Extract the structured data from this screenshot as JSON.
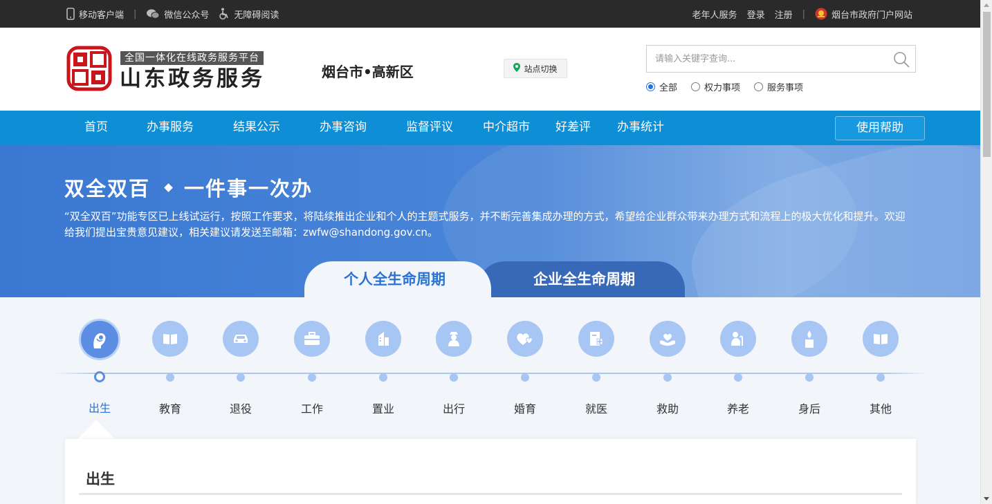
{
  "topbar": {
    "mobile_client": "移动客户端",
    "wechat": "微信公众号",
    "accessible": "无障碍阅读",
    "elder_service": "老年人服务",
    "login": "登录",
    "register": "注册",
    "gov_portal": "烟台市政府门户网站",
    "sep": "|"
  },
  "header": {
    "logo_subtitle": "全国一体化在线政务服务平台",
    "logo_title": "山东政务服务",
    "city": "烟台市•高新区",
    "site_switch": "站点切换",
    "search_placeholder": "请输入关键字查询...",
    "search_scope": [
      {
        "label": "全部",
        "selected": true
      },
      {
        "label": "权力事项",
        "selected": false
      },
      {
        "label": "服务事项",
        "selected": false
      }
    ]
  },
  "nav": {
    "items": [
      "首页",
      "办事服务",
      "结果公示",
      "办事咨询",
      "监督评议",
      "中介超市",
      "好差评",
      "办事统计"
    ],
    "help": "使用帮助"
  },
  "banner": {
    "title_left": "双全双百",
    "title_right": "一件事一次办",
    "description": "“双全双百”功能专区已上线试运行，按照工作要求，将陆续推出企业和个人的主题式服务，并不断完善集成办理的方式，希望给企业群众带来办理方式和流程上的极大优化和提升。欢迎给我们提出宝贵意见建议，相关建议请发送至邮箱：zwfw@shandong.gov.cn。",
    "tab_personal": "个人全生命周期",
    "tab_corporate": "企业全生命周期"
  },
  "lifecycle": {
    "active_index": 0,
    "stages": [
      {
        "label": "出生",
        "icon": "baby-icon"
      },
      {
        "label": "教育",
        "icon": "book-icon"
      },
      {
        "label": "退役",
        "icon": "car-icon"
      },
      {
        "label": "工作",
        "icon": "briefcase-icon"
      },
      {
        "label": "置业",
        "icon": "building-icon"
      },
      {
        "label": "出行",
        "icon": "traveler-icon"
      },
      {
        "label": "婚育",
        "icon": "hearts-icon"
      },
      {
        "label": "就医",
        "icon": "medical-icon"
      },
      {
        "label": "救助",
        "icon": "heart-hand-icon"
      },
      {
        "label": "养老",
        "icon": "elder-icon"
      },
      {
        "label": "身后",
        "icon": "candle-icon"
      },
      {
        "label": "其他",
        "icon": "book-open-icon"
      }
    ]
  },
  "panel": {
    "title": "出生"
  },
  "colors": {
    "nav_bg": "#0d8ed5",
    "accent": "#2a72d4",
    "stage_circle": "#a8c6f4",
    "topbar_bg": "#2a2a2a"
  }
}
